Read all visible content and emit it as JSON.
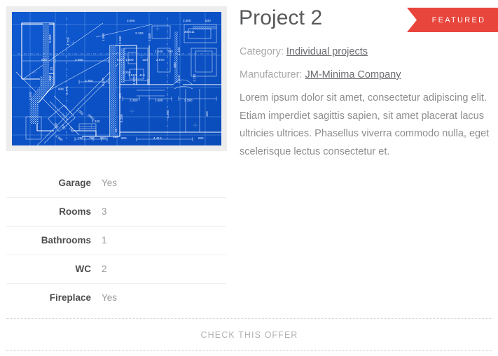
{
  "product": {
    "title": "Project 2",
    "badge": {
      "label": "FEATURED",
      "color": "#e8453c",
      "icon": "ribbon-banner"
    },
    "meta": {
      "category_label": "Category:",
      "category_value": "Individual projects",
      "manufacturer_label": "Manufacturer:",
      "manufacturer_value": "JM-Minima Company"
    },
    "description": "Lorem ipsum dolor sit amet, consectetur adipiscing elit. Etiam imperdiet sagittis sapien, sit amet placerat lacus ultricies ultrices. Phasellus viverra commodo nulla, eget scelerisque lectus consectetur et.",
    "image": {
      "alt": "Architectural blueprint floor plan",
      "background_color": "#0b52c8",
      "frame_color": "#ededed",
      "dimension_labels": [
        "5.360",
        "4.720",
        "1.900",
        "3.650",
        "1.500",
        "3.300",
        "630",
        "2.580",
        "3.150",
        "300x11",
        "1.540",
        "790",
        "1.100",
        "640",
        "4.560",
        "510",
        "1.800",
        "120",
        "2.670",
        "380",
        "20",
        "520",
        "3.360",
        "5.570",
        "2.250",
        "1.510",
        "410",
        "1.370",
        "1.320",
        "1.110",
        "2.400",
        "2.770",
        "640",
        "1.550",
        "(050)",
        "2.330",
        "120",
        "2.280",
        "1.500",
        "2.280",
        "585",
        "710",
        "565",
        "1.980",
        "4.200",
        "4.200",
        "120",
        "720",
        "790",
        "960",
        "520",
        "20",
        "825",
        "4.410",
        "825"
      ]
    },
    "specs": {
      "rows": [
        {
          "label": "Garage",
          "value": "Yes"
        },
        {
          "label": "Rooms",
          "value": "3"
        },
        {
          "label": "Bathrooms",
          "value": "1"
        },
        {
          "label": "WC",
          "value": "2"
        },
        {
          "label": "Fireplace",
          "value": "Yes"
        }
      ]
    },
    "footer": {
      "offer_link": "CHECK THIS OFFER"
    }
  }
}
